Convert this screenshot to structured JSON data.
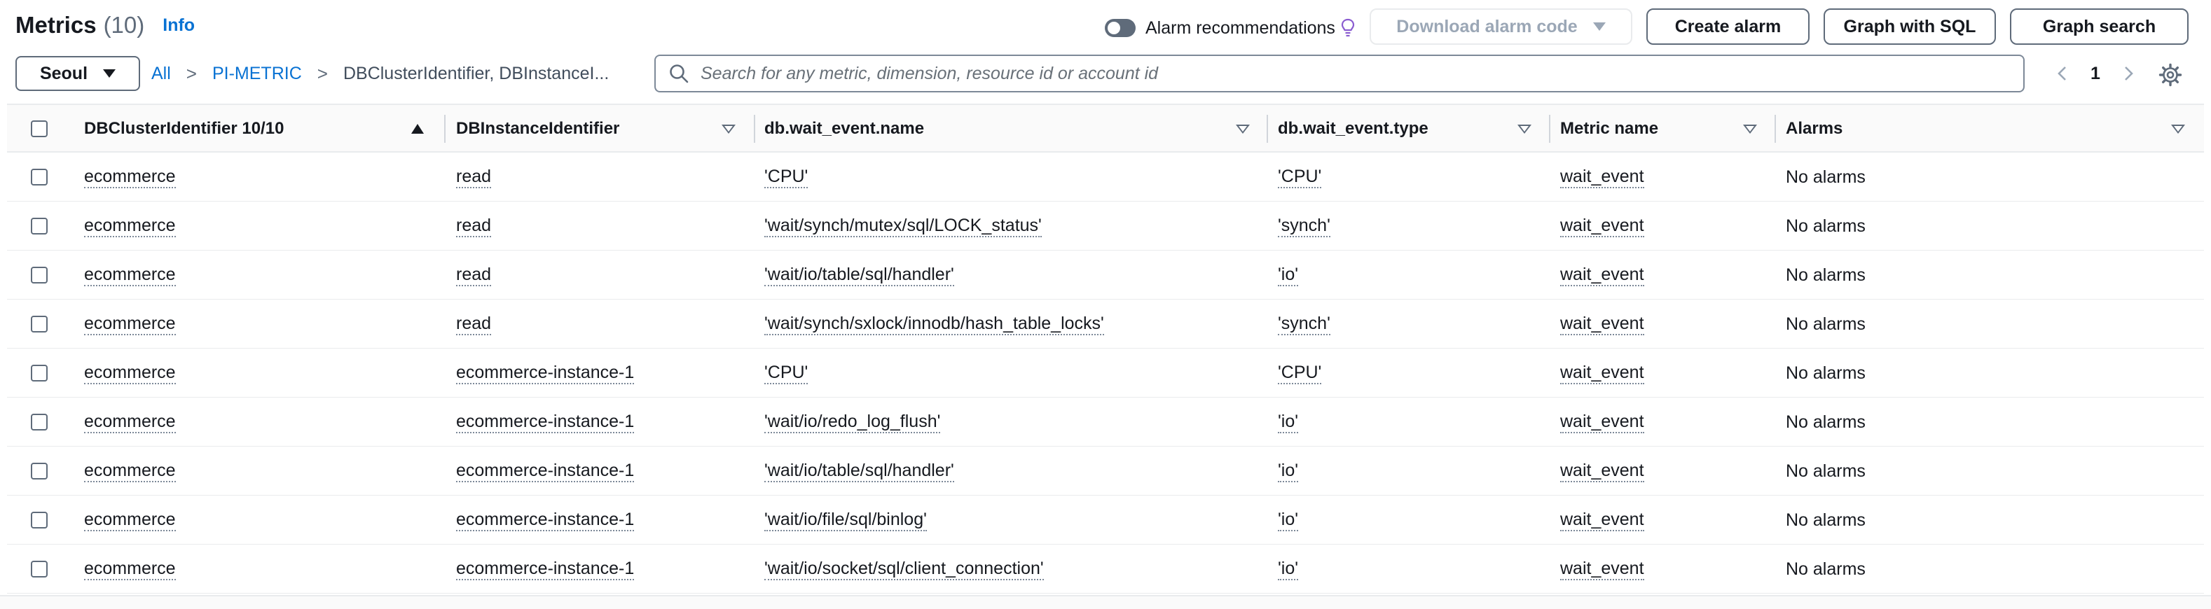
{
  "header": {
    "title": "Metrics",
    "count": "(10)",
    "info": "Info"
  },
  "toolbar": {
    "alarm_recommendations": "Alarm recommendations",
    "download_alarm_code": "Download alarm code",
    "create_alarm": "Create alarm",
    "graph_with_sql": "Graph with SQL",
    "graph_search": "Graph search"
  },
  "region": "Seoul",
  "breadcrumb": {
    "all": "All",
    "namespace": "PI-METRIC",
    "current": "DBClusterIdentifier, DBInstanceI..."
  },
  "search": {
    "placeholder": "Search for any metric, dimension, resource id or account id",
    "value": ""
  },
  "pagination": {
    "page": "1"
  },
  "table": {
    "columns": [
      "DBClusterIdentifier 10/10",
      "DBInstanceIdentifier",
      "db.wait_event.name",
      "db.wait_event.type",
      "Metric name",
      "Alarms"
    ],
    "rows": [
      [
        "ecommerce",
        "read",
        "'CPU'",
        "'CPU'",
        "wait_event",
        "No alarms"
      ],
      [
        "ecommerce",
        "read",
        "'wait/synch/mutex/sql/LOCK_status'",
        "'synch'",
        "wait_event",
        "No alarms"
      ],
      [
        "ecommerce",
        "read",
        "'wait/io/table/sql/handler'",
        "'io'",
        "wait_event",
        "No alarms"
      ],
      [
        "ecommerce",
        "read",
        "'wait/synch/sxlock/innodb/hash_table_locks'",
        "'synch'",
        "wait_event",
        "No alarms"
      ],
      [
        "ecommerce",
        "ecommerce-instance-1",
        "'CPU'",
        "'CPU'",
        "wait_event",
        "No alarms"
      ],
      [
        "ecommerce",
        "ecommerce-instance-1",
        "'wait/io/redo_log_flush'",
        "'io'",
        "wait_event",
        "No alarms"
      ],
      [
        "ecommerce",
        "ecommerce-instance-1",
        "'wait/io/table/sql/handler'",
        "'io'",
        "wait_event",
        "No alarms"
      ],
      [
        "ecommerce",
        "ecommerce-instance-1",
        "'wait/io/file/sql/binlog'",
        "'io'",
        "wait_event",
        "No alarms"
      ],
      [
        "ecommerce",
        "ecommerce-instance-1",
        "'wait/io/socket/sql/client_connection'",
        "'io'",
        "wait_event",
        "No alarms"
      ]
    ]
  },
  "colors": {
    "link": "#0972d3",
    "border": "#5f6b7a",
    "disabled": "#9ba7b6",
    "header_bg": "#fafafa"
  },
  "icons": [
    "toggle-switch",
    "lightbulb-icon",
    "caret-down-icon",
    "search-icon",
    "chevron-left-icon",
    "chevron-right-icon",
    "gear-icon",
    "sort-ascending-icon",
    "sort-descending-icon"
  ]
}
